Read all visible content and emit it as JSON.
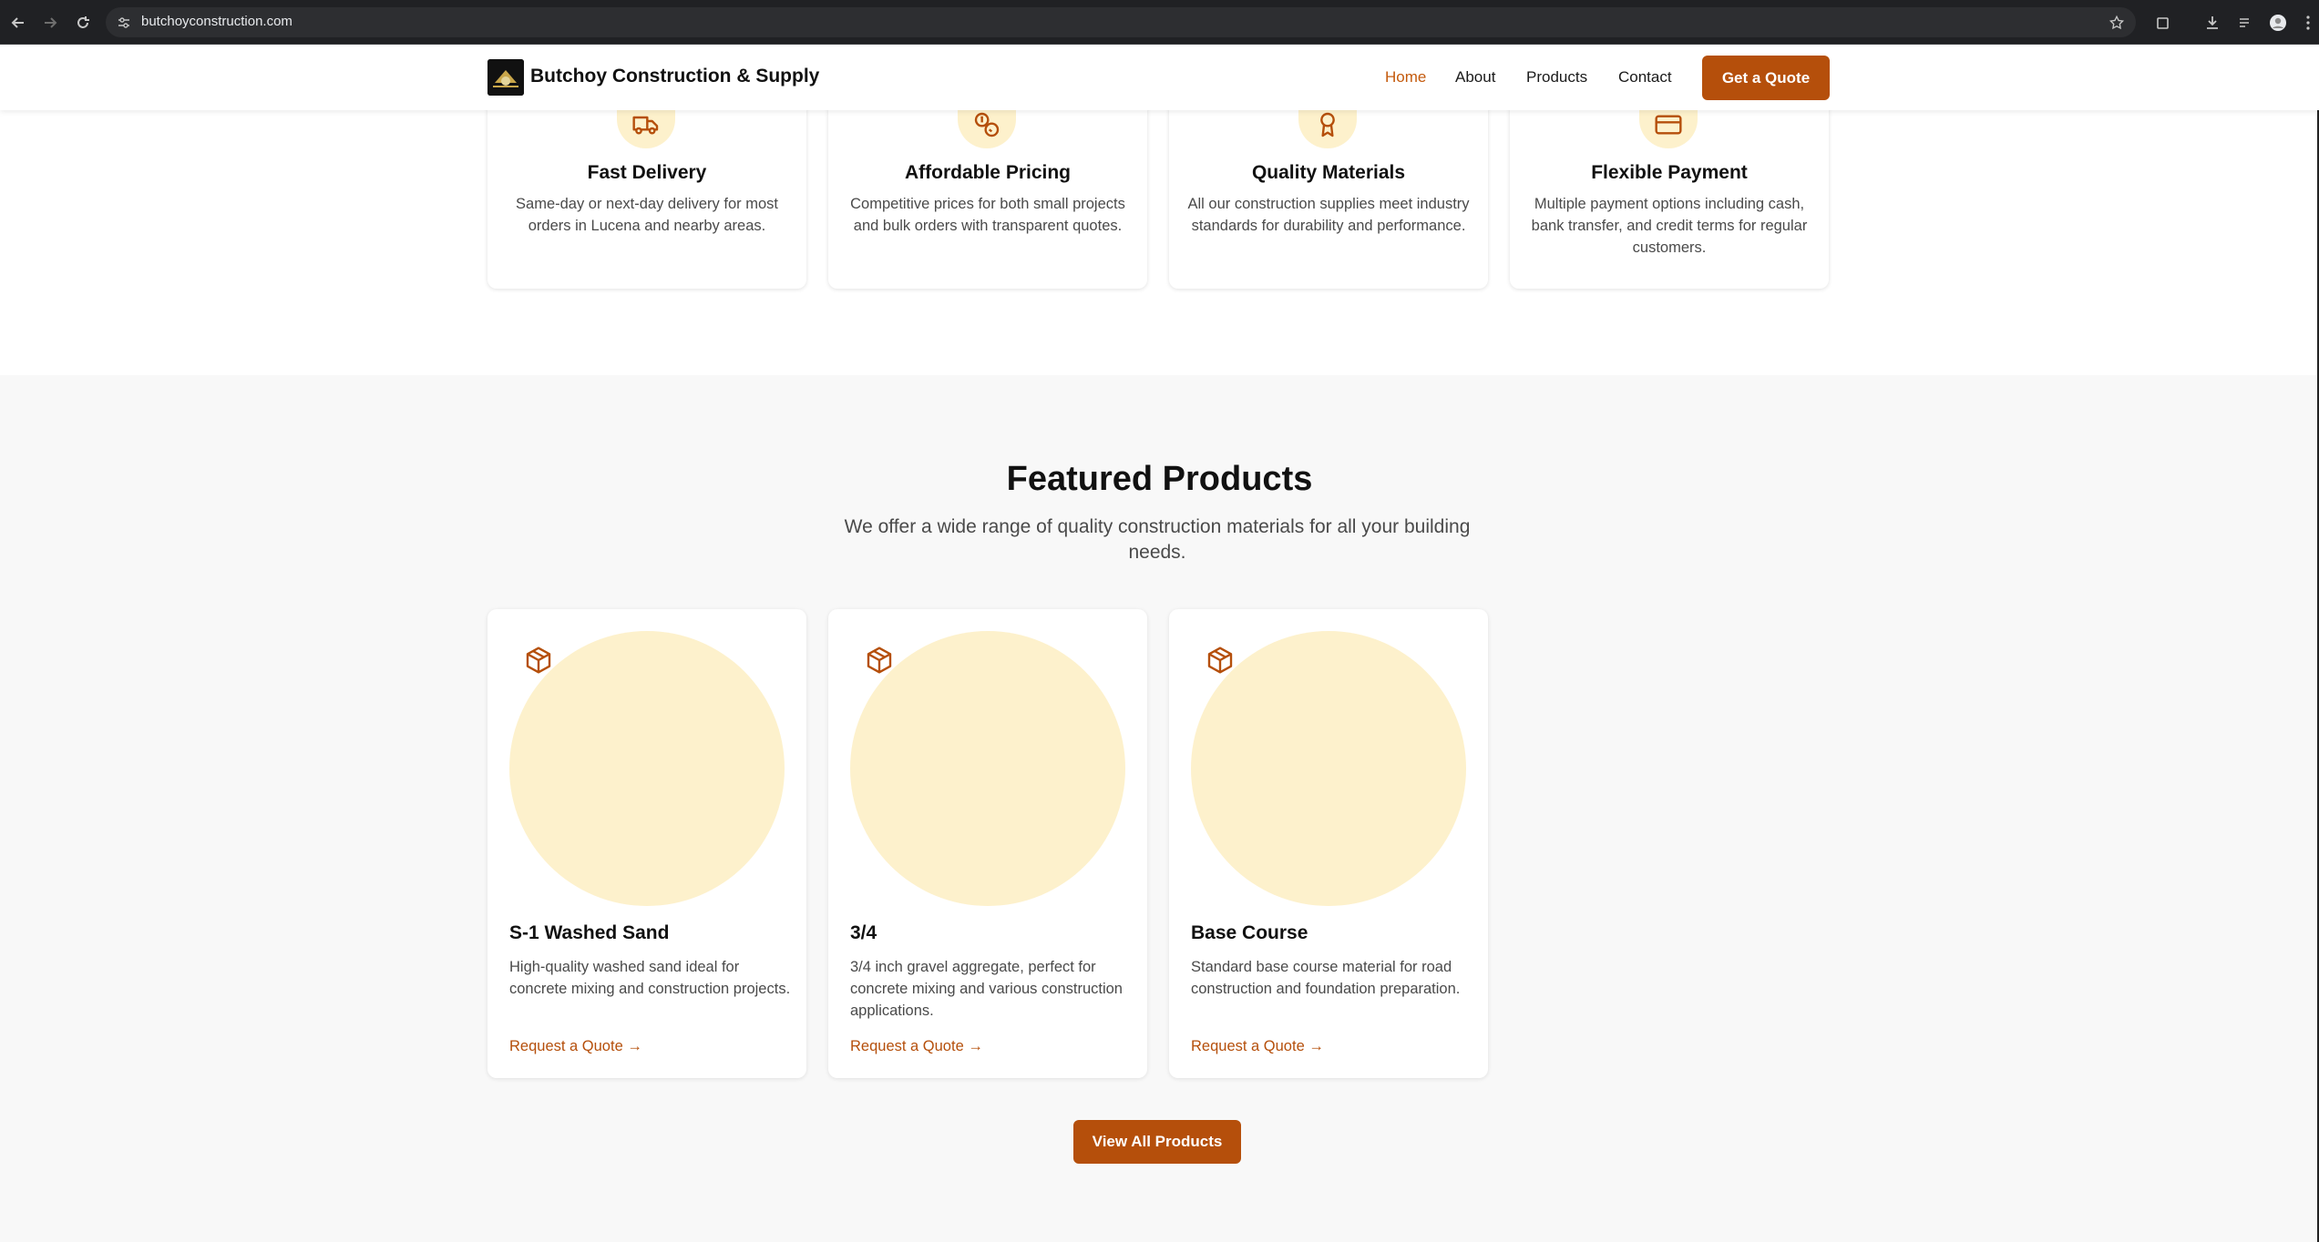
{
  "browser": {
    "url": "butchoyconstruction.com",
    "back_icon": "arrow-left-icon",
    "forward_icon": "arrow-right-icon",
    "reload_icon": "reload-icon"
  },
  "header": {
    "brand": "Butchoy Construction & Supply",
    "nav": [
      "Home",
      "About",
      "Products",
      "Contact"
    ],
    "cta": "Get a Quote"
  },
  "features": [
    {
      "icon": "truck-icon",
      "title": "Fast Delivery",
      "desc": "Same-day or next-day delivery for most orders in Lucena and nearby areas."
    },
    {
      "icon": "coins-icon",
      "title": "Affordable Pricing",
      "desc": "Competitive prices for both small projects and bulk orders with transparent quotes."
    },
    {
      "icon": "award-icon",
      "title": "Quality Materials",
      "desc": "All our construction supplies meet industry standards for durability and performance."
    },
    {
      "icon": "credit-card-icon",
      "title": "Flexible Payment",
      "desc": "Multiple payment options including cash, bank transfer, and credit terms for regular customers."
    }
  ],
  "products_section": {
    "title": "Featured Products",
    "subtitle": "We offer a wide range of quality construction materials for all your building needs.",
    "items": [
      {
        "name": "S-1 Washed Sand",
        "desc": "High-quality washed sand ideal for concrete mixing and construction projects.",
        "link": "Request a Quote →"
      },
      {
        "name": "3/4",
        "desc": "3/4 inch gravel aggregate, perfect for concrete mixing and various construction applications.",
        "link": "Request a Quote →"
      },
      {
        "name": "Base Course",
        "desc": "Standard base course material for road construction and foundation preparation.",
        "link": "Request a Quote →"
      }
    ],
    "view_all": "View All Products"
  },
  "colors": {
    "accent": "#b54f0b",
    "icon_bg": "#fdf1cc",
    "section_bg": "#f8f8f8"
  }
}
